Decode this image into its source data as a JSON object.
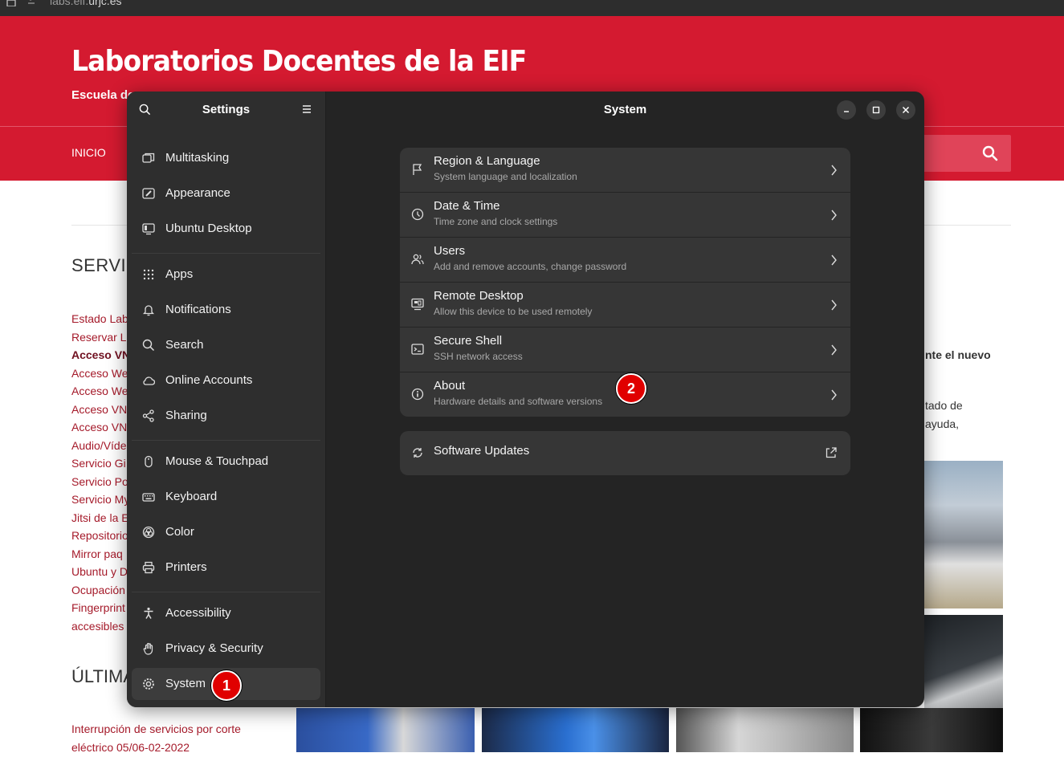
{
  "browser": {
    "url_prefix": "labs.eif.",
    "url_domain": "urjc.es"
  },
  "site": {
    "title": "Laboratorios Docentes de la EIF",
    "subtitle": "Escuela de",
    "nav_item": "INICIO",
    "section_title": "SERVIC",
    "section_title2": "ÚLTIMA",
    "links": [
      "Estado Lab",
      "Reservar L",
      "Acceso VN",
      "Acceso We",
      "Acceso We",
      "Acceso VN",
      "Acceso VN",
      "Audio/Víde",
      "Servicio Gi",
      "Servicio Po",
      "Servicio My",
      "Jitsi de la E",
      "Repositorio",
      "Mirror paq",
      "Ubuntu y D",
      "Ocupación",
      "Fingerprint",
      "accesibles"
    ],
    "news": "Interrupción de servicios por corte eléctrico 05/06-02-2022",
    "right_bold": "nte el nuevo",
    "right_text1": "tado de",
    "right_text2": "ayuda,"
  },
  "settings": {
    "sidebar_title": "Settings",
    "title": "System",
    "sidebar": [
      {
        "label": "Multitasking",
        "icon": "multitasking-icon"
      },
      {
        "label": "Appearance",
        "icon": "appearance-icon"
      },
      {
        "label": "Ubuntu Desktop",
        "icon": "ubuntu-desktop-icon"
      },
      {
        "label": "Apps",
        "icon": "apps-icon"
      },
      {
        "label": "Notifications",
        "icon": "bell-icon"
      },
      {
        "label": "Search",
        "icon": "search-icon"
      },
      {
        "label": "Online Accounts",
        "icon": "cloud-icon"
      },
      {
        "label": "Sharing",
        "icon": "share-icon"
      },
      {
        "label": "Mouse & Touchpad",
        "icon": "mouse-icon"
      },
      {
        "label": "Keyboard",
        "icon": "keyboard-icon"
      },
      {
        "label": "Color",
        "icon": "color-icon"
      },
      {
        "label": "Printers",
        "icon": "printer-icon"
      },
      {
        "label": "Accessibility",
        "icon": "accessibility-icon"
      },
      {
        "label": "Privacy & Security",
        "icon": "hand-icon"
      },
      {
        "label": "System",
        "icon": "system-gear-icon"
      }
    ],
    "rows": [
      {
        "title": "Region & Language",
        "subtitle": "System language and localization",
        "icon": "flag-icon"
      },
      {
        "title": "Date & Time",
        "subtitle": "Time zone and clock settings",
        "icon": "clock-icon"
      },
      {
        "title": "Users",
        "subtitle": "Add and remove accounts, change password",
        "icon": "users-icon"
      },
      {
        "title": "Remote Desktop",
        "subtitle": "Allow this device to be used remotely",
        "icon": "remote-desktop-icon"
      },
      {
        "title": "Secure Shell",
        "subtitle": "SSH network access",
        "icon": "terminal-icon"
      },
      {
        "title": "About",
        "subtitle": "Hardware details and software versions",
        "icon": "info-icon"
      }
    ],
    "software_updates": "Software Updates"
  },
  "markers": [
    "1",
    "2"
  ],
  "colors": {
    "site_red": "#d41a30",
    "window_bg": "#242424",
    "sidebar_bg": "#2e2e2e",
    "row_bg": "#363636",
    "marker": "#e00000"
  }
}
